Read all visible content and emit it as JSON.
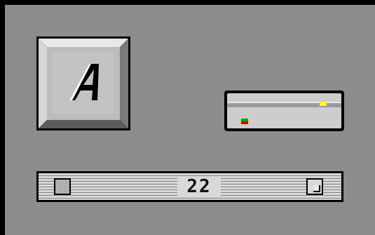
{
  "key_button": {
    "icon": "letter-a-icon",
    "letter": "A"
  },
  "drive": {
    "status_leds": [
      "yellow",
      "red",
      "green"
    ]
  },
  "slider": {
    "value": "22"
  },
  "colors": {
    "background": "#8c8c8c",
    "border": "#000000",
    "led_yellow": "#ffff00",
    "led_red": "#cc0000",
    "led_green": "#00aa00"
  }
}
